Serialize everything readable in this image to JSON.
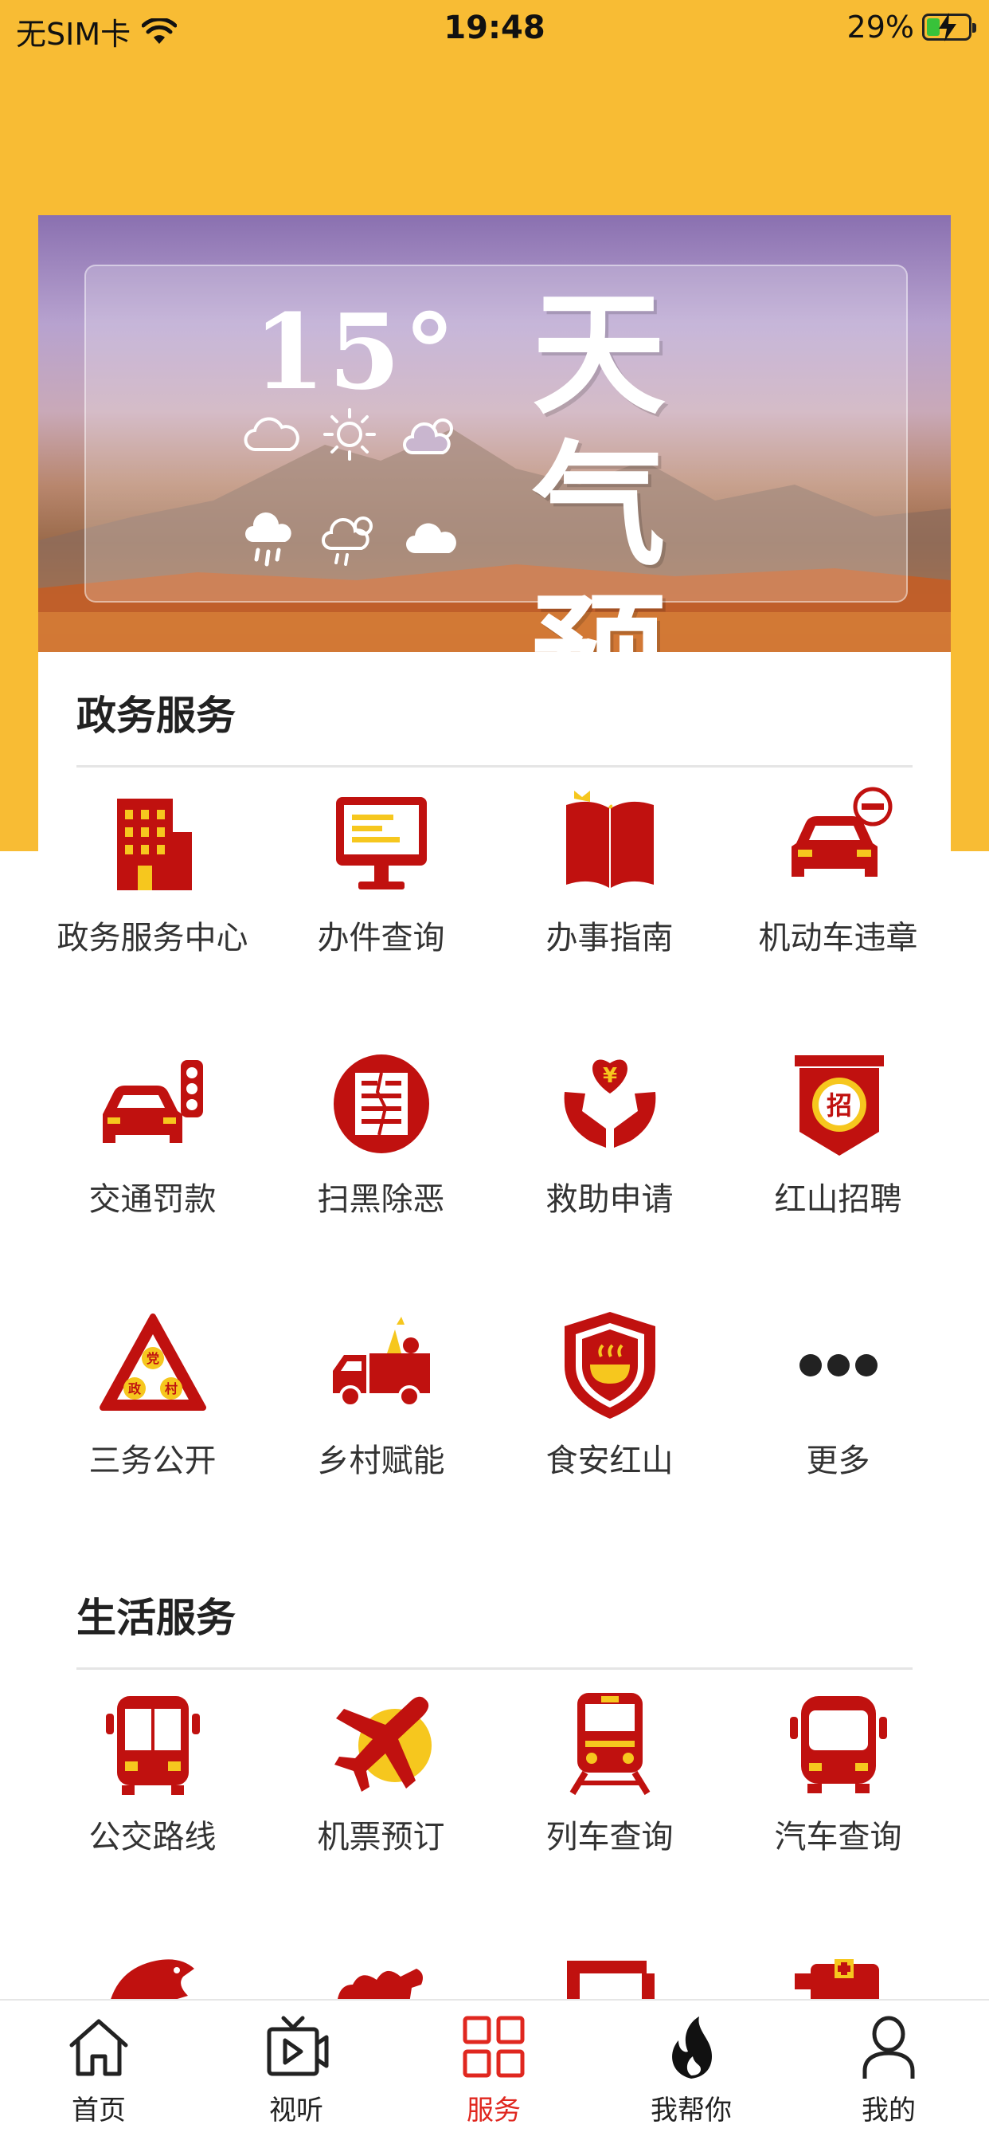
{
  "status": {
    "carrier": "无SIM卡",
    "time": "19:48",
    "battery": "29%"
  },
  "banner": {
    "temperature": "15°",
    "title_line1": "天气",
    "title_line2": "预报"
  },
  "gov_services": {
    "title": "政务服务",
    "items": [
      {
        "label": "政务服务中心",
        "icon": "government-building-icon"
      },
      {
        "label": "办件查询",
        "icon": "monitor-icon"
      },
      {
        "label": "办事指南",
        "icon": "book-icon"
      },
      {
        "label": "机动车违章",
        "icon": "car-prohibited-icon"
      },
      {
        "label": "交通罚款",
        "icon": "car-traffic-light-icon"
      },
      {
        "label": "扫黑除恶",
        "icon": "anti-crime-icon"
      },
      {
        "label": "救助申请",
        "icon": "helping-hands-icon"
      },
      {
        "label": "红山招聘",
        "icon": "recruit-icon"
      },
      {
        "label": "三务公开",
        "icon": "warning-triangle-icon",
        "glyphs": [
          "党",
          "政",
          "村"
        ]
      },
      {
        "label": "乡村赋能",
        "icon": "truck-icon"
      },
      {
        "label": "食安红山",
        "icon": "food-shield-icon"
      },
      {
        "label": "更多",
        "icon": "more-icon"
      }
    ],
    "icon_glyphs": {
      "recruit": "招",
      "yuan": "¥"
    }
  },
  "life_services": {
    "title": "生活服务",
    "items": [
      {
        "label": "公交路线",
        "icon": "bus-icon"
      },
      {
        "label": "机票预订",
        "icon": "airplane-icon"
      },
      {
        "label": "列车查询",
        "icon": "train-icon"
      },
      {
        "label": "汽车查询",
        "icon": "coach-icon"
      }
    ]
  },
  "tabbar": {
    "items": [
      {
        "label": "首页",
        "icon": "home-icon"
      },
      {
        "label": "视听",
        "icon": "tv-icon"
      },
      {
        "label": "服务",
        "icon": "grid-icon",
        "active": true
      },
      {
        "label": "我帮你",
        "icon": "flame-icon"
      },
      {
        "label": "我的",
        "icon": "user-icon"
      }
    ]
  },
  "colors": {
    "brand_yellow": "#F8BC34",
    "icon_red": "#C0110F",
    "icon_yellow": "#F6C71E",
    "active_tab": "#e0271f"
  }
}
